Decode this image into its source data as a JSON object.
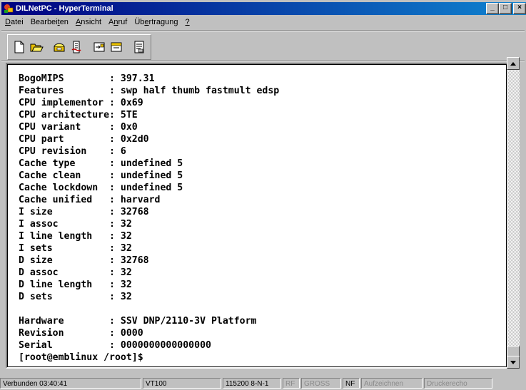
{
  "window": {
    "title": "DILNetPC - HyperTerminal"
  },
  "title_buttons": {
    "minimize": "_",
    "maximize": "□",
    "close": "×"
  },
  "menu": [
    {
      "label": "Datei",
      "ul": "D",
      "rest": "atei"
    },
    {
      "label": "Bearbeiten",
      "pre": "Bearbei",
      "ul": "t",
      "rest": "en"
    },
    {
      "label": "Ansicht",
      "ul": "A",
      "rest": "nsicht"
    },
    {
      "label": "Anruf",
      "pre": "A",
      "ul": "n",
      "rest": "ruf"
    },
    {
      "label": "Übertragung",
      "pre": "Üb",
      "ul": "e",
      "rest": "rtragung"
    },
    {
      "label": "?",
      "ul": "?",
      "rest": ""
    }
  ],
  "toolbar": [
    "new-icon",
    "open-icon",
    "connect-phone-icon",
    "disconnect-icon",
    "send-icon",
    "receive-icon",
    "properties-icon"
  ],
  "terminal": {
    "lines": [
      "BogoMIPS        : 397.31",
      "Features        : swp half thumb fastmult edsp",
      "CPU implementor : 0x69",
      "CPU architecture: 5TE",
      "CPU variant     : 0x0",
      "CPU part        : 0x2d0",
      "CPU revision    : 6",
      "Cache type      : undefined 5",
      "Cache clean     : undefined 5",
      "Cache lockdown  : undefined 5",
      "Cache unified   : harvard",
      "I size          : 32768",
      "I assoc         : 32",
      "I line length   : 32",
      "I sets          : 32",
      "D size          : 32768",
      "D assoc         : 32",
      "D line length   : 32",
      "D sets          : 32",
      "",
      "Hardware        : SSV DNP/2110-3V Platform",
      "Revision        : 0000",
      "Serial          : 0000000000000000",
      "[root@emblinux /root]$"
    ]
  },
  "status": {
    "connected": "Verbunden 03:40:41",
    "emulation": "VT100",
    "port": "115200 8-N-1",
    "rf": "RF",
    "gross": "GROSS",
    "nf": "NF",
    "record": "Aufzeichnen",
    "echo": "Druckerecho"
  }
}
